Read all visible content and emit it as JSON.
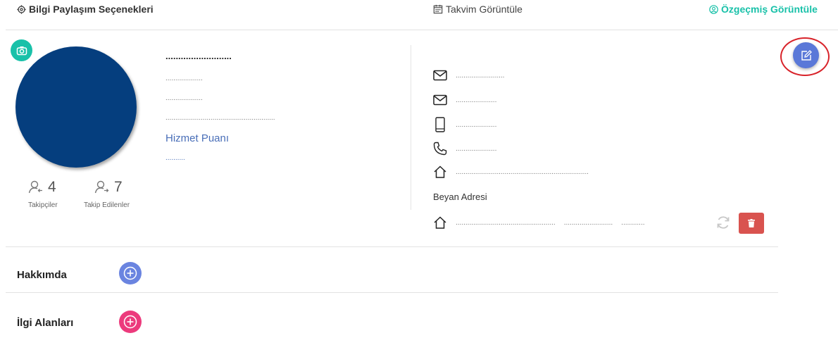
{
  "topbar": {
    "share_options": "Bilgi Paylaşım Seçenekleri",
    "calendar": "Takvim Görüntüle",
    "resume": "Özgeçmiş Görüntüle"
  },
  "colors": {
    "teal": "#19c1a9",
    "avatar_blue": "#053e7e",
    "edit_blue": "#5a78d8",
    "red_ring": "#d8232a",
    "delete_red": "#d9534f",
    "add_blue": "#6a84e0",
    "add_pink": "#ec3a7c",
    "link_blue": "#4a6fb8"
  },
  "profile": {
    "name": "..........................",
    "line1": "...................",
    "line2": "...................",
    "line3": "........................................................",
    "service_score_label": "Hizmet Puanı",
    "service_score_value": "..........",
    "followers_count": "4",
    "followers_label": "Takipçiler",
    "following_count": "7",
    "following_label": "Takip Edilenler"
  },
  "contact": {
    "email1": ".........................",
    "email2": ".....................",
    "mobile": ".....................",
    "phone": ".....................",
    "address": "....................................................................",
    "declared_address_label": "Beyan Adresi",
    "declared_address_part1": "...................................................",
    "declared_address_part2": ".........................",
    "declared_address_part3": "............"
  },
  "sections": {
    "about": "Hakkımda",
    "interests": "İlgi Alanları"
  }
}
